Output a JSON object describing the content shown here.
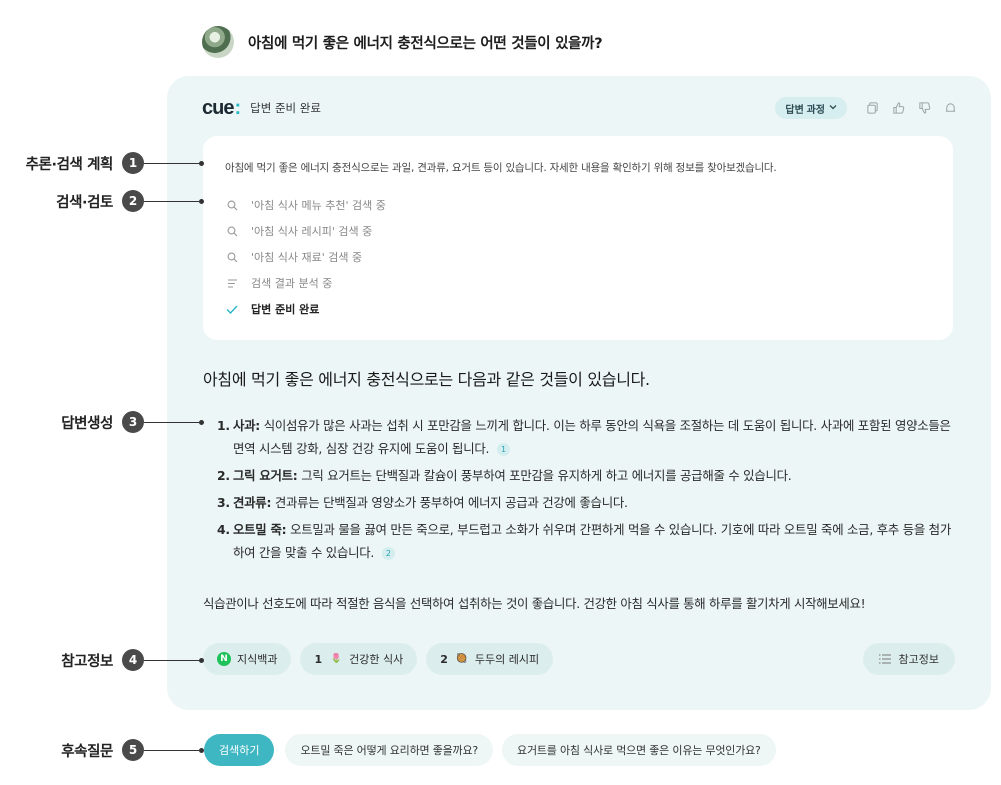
{
  "question": {
    "text": "아침에 먹기 좋은 에너지 충전식으로는 어떤 것들이 있을까?"
  },
  "card": {
    "logo_text": "cue",
    "logo_dot": ":",
    "status": "답변 준비 완료",
    "process_button": "답변 과정",
    "header_icons": [
      "copy-icon",
      "thumbs-up-icon",
      "thumbs-down-icon",
      "notification-icon"
    ]
  },
  "process": {
    "plan": "아침에 먹기 좋은 에너지 충전식으로는 과일, 견과류, 요거트 등이 있습니다. 자세한 내용을 확인하기 위해 정보를 찾아보겠습니다.",
    "steps": [
      {
        "icon": "search-icon",
        "label": "'아침 식사 메뉴 추천' 검색 중"
      },
      {
        "icon": "search-icon",
        "label": "'아침 식사 레시피' 검색 중"
      },
      {
        "icon": "search-icon",
        "label": "'아침 식사 재료' 검색 중"
      },
      {
        "icon": "analyze-icon",
        "label": "검색 결과 분석 중"
      },
      {
        "icon": "check-icon",
        "label": "답변 준비 완료"
      }
    ]
  },
  "answer": {
    "title": "아침에 먹기 좋은 에너지 충전식으로는 다음과 같은 것들이 있습니다.",
    "items": [
      {
        "num": "1.",
        "term": "사과:",
        "text": " 식이섬유가 많은 사과는 섭취 시 포만감을 느끼게 합니다. 이는 하루 동안의 식욕을 조절하는 데 도움이 됩니다. 사과에 포함된 영양소들은 면역 시스템 강화, 심장 건강 유지에 도움이 됩니다.",
        "cite": "1"
      },
      {
        "num": "2.",
        "term": "그릭 요거트:",
        "text": " 그릭 요거트는 단백질과 칼슘이 풍부하여 포만감을 유지하게 하고 에너지를 공급해줄 수 있습니다.",
        "cite": ""
      },
      {
        "num": "3.",
        "term": "견과류:",
        "text": " 견과류는 단백질과 영양소가 풍부하여 에너지 공급과 건강에 좋습니다.",
        "cite": ""
      },
      {
        "num": "4.",
        "term": "오트밀 죽:",
        "text": " 오트밀과 물을 끓여 만든 죽으로, 부드럽고 소화가 쉬우며 간편하게 먹을 수 있습니다. 기호에 따라 오트밀 죽에 소금, 후추 등을 첨가하여 간을 맞출 수 있습니다.",
        "cite": "2"
      }
    ],
    "footer": "식습관이나 선호도에 따라 적절한 음식을 선택하여 섭취하는 것이 좋습니다. 건강한 아침 식사를 통해 하루를 활기차게 시작해보세요!"
  },
  "references": {
    "chips": [
      {
        "num": "",
        "badge": "N",
        "badge_color": "#1ec15a",
        "label": "지식백과"
      },
      {
        "num": "1",
        "badge": "🌷",
        "badge_color": "#ffffff",
        "label": "건강한 식사"
      },
      {
        "num": "2",
        "badge": "🥘",
        "badge_color": "#ffffff",
        "label": "두두의 레시피"
      }
    ],
    "all_label": "참고정보"
  },
  "followups": {
    "search_label": "검색하기",
    "questions": [
      "오트밀 죽은 어떻게 요리하면 좋을까요?",
      "요거트를 아침 식사로 먹으면 좋은 이유는 무엇인가요?"
    ]
  },
  "annotations": [
    {
      "label": "추론·검색 계획",
      "num": "1"
    },
    {
      "label": "검색·검토",
      "num": "2"
    },
    {
      "label": "답변생성",
      "num": "3"
    },
    {
      "label": "참고정보",
      "num": "4"
    },
    {
      "label": "후속질문",
      "num": "5"
    }
  ],
  "colors": {
    "accent": "#27b7c4",
    "card_bg": "#ecf6f6",
    "chip_bg": "#dcedee"
  }
}
